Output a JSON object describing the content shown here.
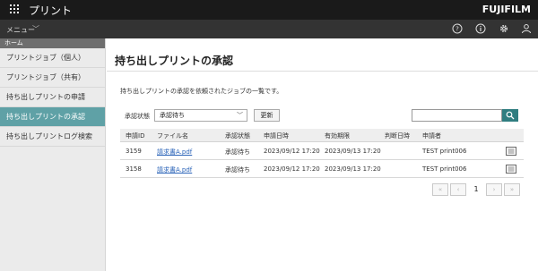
{
  "app": {
    "title": "プリント",
    "brand": "FUJIFILM"
  },
  "menubar": {
    "menu_label": "メニュー"
  },
  "sidebar": {
    "home": "ホーム",
    "items": [
      {
        "label": "プリントジョブ（個人）"
      },
      {
        "label": "プリントジョブ（共有）"
      },
      {
        "label": "持ち出しプリントの申請"
      },
      {
        "label": "持ち出しプリントの承認"
      },
      {
        "label": "持ち出しプリントログ検索"
      }
    ]
  },
  "main": {
    "title": "持ち出しプリントの承認",
    "description": "持ち出しプリントの承認を依頼されたジョブの一覧です。",
    "filter_label": "承認状態",
    "filter_value": "承認待ち",
    "refresh_label": "更新",
    "search_placeholder": ""
  },
  "table": {
    "headers": [
      "申請ID",
      "ファイル名",
      "承認状態",
      "申請日時",
      "有効期限",
      "判断日時",
      "申請者"
    ],
    "rows": [
      {
        "id": "3159",
        "file": "請求書A.pdf",
        "status": "承認待ち",
        "applied": "2023/09/12 17:20",
        "expires": "2023/09/13 17:20",
        "decided": "",
        "applicant": "TEST print006"
      },
      {
        "id": "3158",
        "file": "請求書A.pdf",
        "status": "承認待ち",
        "applied": "2023/09/12 17:20",
        "expires": "2023/09/13 17:20",
        "decided": "",
        "applicant": "TEST print006"
      }
    ]
  },
  "pagination": {
    "current_page": "1"
  },
  "icons": {
    "app_launcher": "grid-icon",
    "help": "help-icon",
    "info": "info-icon",
    "settings": "gear-icon",
    "user": "user-icon",
    "search": "search-icon",
    "row_detail": "document-icon"
  },
  "colors": {
    "active_nav": "#5fa1a6",
    "search_button": "#2f7d80",
    "link": "#2a63b8"
  }
}
